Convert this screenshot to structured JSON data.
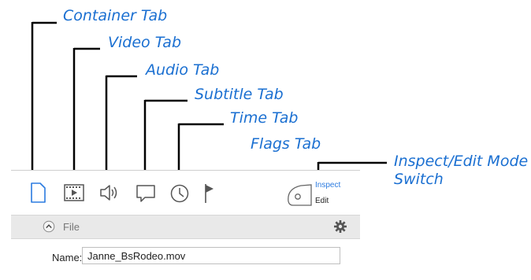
{
  "callouts": {
    "container_tab": "Container Tab",
    "video_tab": "Video Tab",
    "audio_tab": "Audio Tab",
    "subtitle_tab": "Subtitle Tab",
    "time_tab": "Time Tab",
    "flags_tab": "Flags Tab",
    "mode_switch_line1": "Inspect/Edit Mode",
    "mode_switch_line2": "Switch"
  },
  "mode_switch": {
    "inspect_label": "Inspect",
    "edit_label": "Edit"
  },
  "section": {
    "title": "File"
  },
  "fields": {
    "name_label": "Name:",
    "name_value": "Janne_BsRodeo.mov"
  },
  "colors": {
    "callout_text": "#1a6fd1",
    "leader_line": "#000000",
    "active_tab_icon": "#2b7be0",
    "inactive_tab_icon": "#555555",
    "section_bar": "#e9e9e9"
  },
  "icons": {
    "container": "document-icon",
    "video": "film-icon",
    "audio": "speaker-icon",
    "subtitle": "speech-bubble-icon",
    "time": "clock-icon",
    "flags": "flag-icon",
    "mode_switch": "mode-switch-icon",
    "collapse": "chevron-up-circle-icon",
    "settings": "gear-icon"
  }
}
